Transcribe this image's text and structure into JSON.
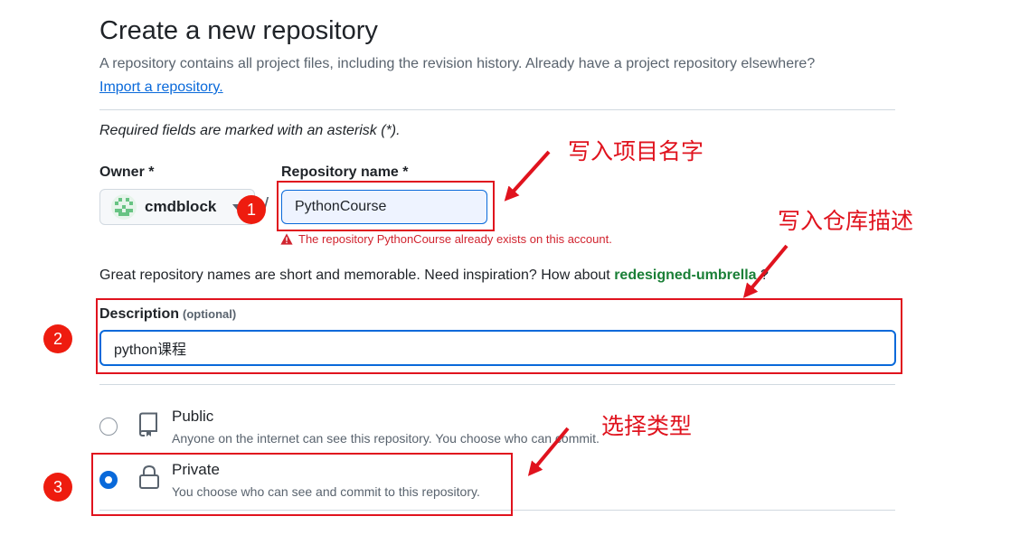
{
  "header": {
    "title": "Create a new repository",
    "subtitle": "A repository contains all project files, including the revision history. Already have a project repository elsewhere?",
    "import_link": "Import a repository."
  },
  "required_note": "Required fields are marked with an asterisk (*).",
  "owner": {
    "label": "Owner *",
    "value": "cmdblock",
    "avatar_icon": "identicon-avatar"
  },
  "separator": "/",
  "repo_name": {
    "label": "Repository name *",
    "value": "PythonCourse",
    "error": "The repository PythonCourse already exists on this account.",
    "error_icon": "alert-icon"
  },
  "hint": {
    "text": "Great repository names are short and memorable. Need inspiration? How about",
    "suggestion": "redesigned-umbrella",
    "suffix": "?"
  },
  "description": {
    "label": "Description",
    "optional": "(optional)",
    "value": "python课程"
  },
  "visibility": {
    "options": [
      {
        "title": "Public",
        "desc": "Anyone on the internet can see this repository. You choose who can commit.",
        "icon": "repo-icon",
        "checked": false
      },
      {
        "title": "Private",
        "desc": "You choose who can see and commit to this repository.",
        "icon": "lock-icon",
        "checked": true
      }
    ]
  },
  "annotations": {
    "name_note": "写入项目名字",
    "desc_note": "写入仓库描述",
    "type_note": "选择类型",
    "badges": [
      "1",
      "2",
      "3"
    ]
  },
  "colors": {
    "accent": "#0969da",
    "annotation_red": "#e0131e",
    "error": "#d1242f",
    "success_link": "#1a7f37"
  }
}
